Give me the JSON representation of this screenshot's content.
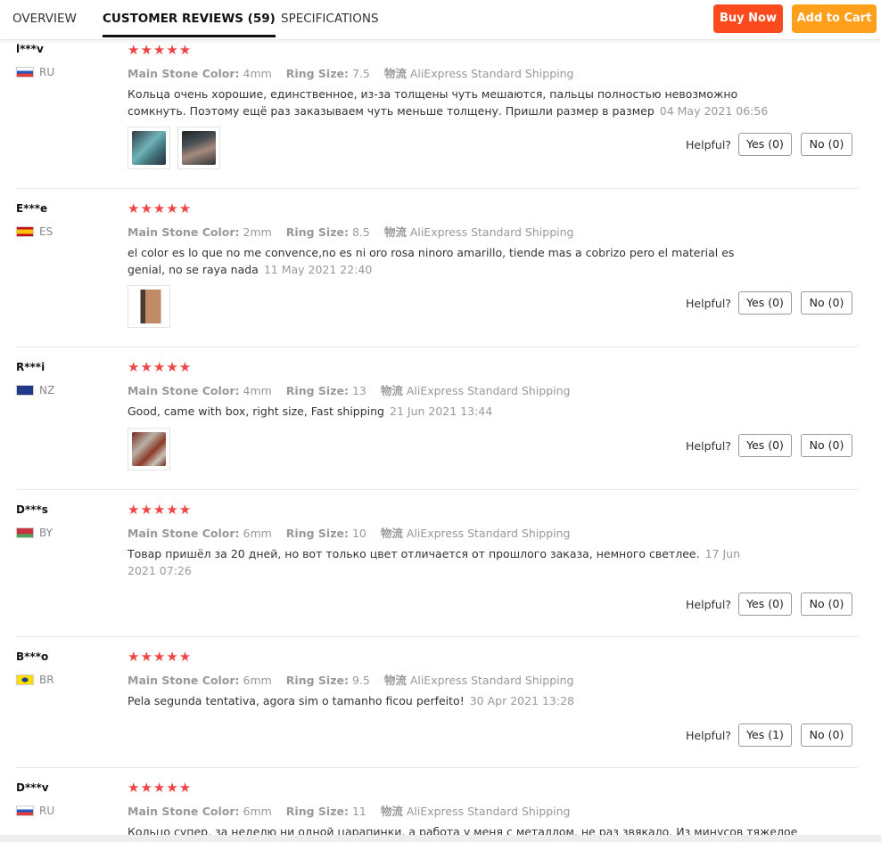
{
  "tabs": [
    {
      "label": "OVERVIEW"
    },
    {
      "label": "CUSTOMER REVIEWS (59)"
    },
    {
      "label": "SPECIFICATIONS"
    }
  ],
  "buttons": {
    "buy_now": "Buy Now",
    "add_to_cart": "Add to Cart"
  },
  "labels": {
    "main_stone": "Main Stone Color:",
    "ring_size": "Ring Size:",
    "shipping_label": "物流",
    "helpful": "Helpful?"
  },
  "rating_stars": "★★★★★",
  "reviews": [
    {
      "user": "l***v",
      "country": "RU",
      "stone": "4mm",
      "size": "7.5",
      "shipping": "AliExpress Standard Shipping",
      "text": "Кольца очень хорошие, единственное, из-за толщены чуть мешаются, пальцы полностью невозможно сомкнуть. Поэтому ещё раз заказываем чуть меньше толщену. Пришли размер в размер",
      "date": "04 May 2021 06:56",
      "yes": "Yes (0)",
      "no": "No (0)"
    },
    {
      "user": "E***e",
      "country": "ES",
      "stone": "2mm",
      "size": "8.5",
      "shipping": "AliExpress Standard Shipping",
      "text": "el color es lo que no me convence,no es ni oro rosa ninoro amarillo, tiende mas a cobrizo pero el material es genial, no se raya nada",
      "date": "11 May 2021 22:40",
      "yes": "Yes (0)",
      "no": "No (0)"
    },
    {
      "user": "R***i",
      "country": "NZ",
      "stone": "4mm",
      "size": "13",
      "shipping": "AliExpress Standard Shipping",
      "text": "Good, came with box, right size, Fast shipping",
      "date": "21 Jun 2021 13:44",
      "yes": "Yes (0)",
      "no": "No (0)"
    },
    {
      "user": "D***s",
      "country": "BY",
      "stone": "6mm",
      "size": "10",
      "shipping": "AliExpress Standard Shipping",
      "text": "Товар пришёл за 20 дней, но вот только цвет отличается от прошлого заказа, немного светлее.",
      "date": "17 Jun 2021 07:26",
      "yes": "Yes (0)",
      "no": "No (0)"
    },
    {
      "user": "B***o",
      "country": "BR",
      "stone": "6mm",
      "size": "9.5",
      "shipping": "AliExpress Standard Shipping",
      "text": "Pela segunda tentativa, agora sim o tamanho ficou perfeito!",
      "date": "30 Apr 2021 13:28",
      "yes": "Yes (1)",
      "no": "No (0)"
    },
    {
      "user": "D***v",
      "country": "RU",
      "stone": "6mm",
      "size": "11",
      "shipping": "AliExpress Standard Shipping",
      "text": "Кольцо супер, за неделю ни одной царапинки, а работа у меня с металлом, не раз звякало. Из минусов тяжелое",
      "date": "",
      "yes": "",
      "no": ""
    }
  ],
  "colors": {
    "buy_now": "#fa4a1e",
    "add_to_cart": "#ff9f1a",
    "stars": "#f04444"
  }
}
